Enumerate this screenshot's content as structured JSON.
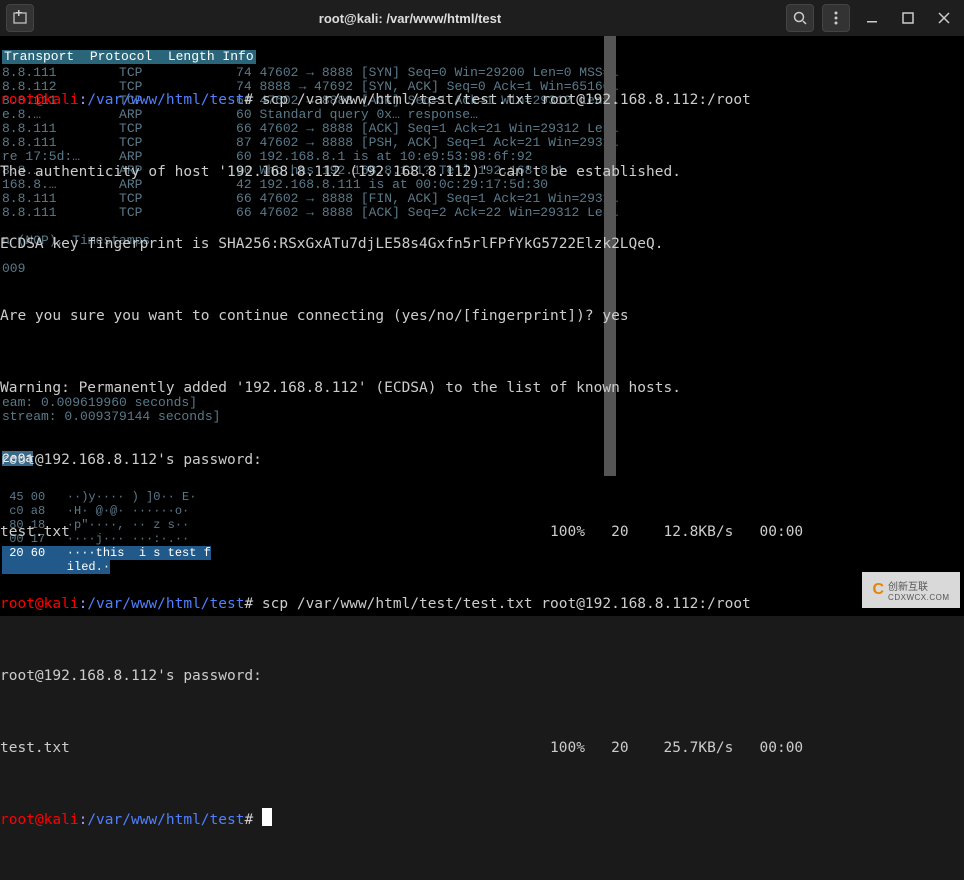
{
  "titlebar": {
    "title": "root@kali: /var/www/html/test"
  },
  "prompt": {
    "userhost": "root@kali",
    "colon": ":",
    "path": "/var/www/html/test",
    "pound": "# "
  },
  "cmd1": "scp /var/www/html/test/test.txt root@192.168.8.112:/root",
  "out": {
    "auth1": "The authenticity of host '192.168.8.112 (192.168.8.112)' can't be established.",
    "auth2": "ECDSA key fingerprint is SHA256:RSxGxATu7djLE58s4Gxfn5rlFPfYkG5722Elzk2LQeQ.",
    "auth3_pre": "Are you sure you want to continue connecting (yes/no/[fingerprint])? ",
    "auth3_ans": "yes",
    "warn": "Warning: Permanently added '192.168.8.112' (ECDSA) to the list of known hosts.",
    "pw1": "root@192.168.8.112's password:",
    "file1": "test.txt",
    "stat1": "100%   20    12.8KB/s   00:00",
    "pw2": "root@192.168.8.112's password:",
    "file2": "test.txt",
    "stat2": "100%   20    25.7KB/s   00:00"
  },
  "cmd2": "scp /var/www/html/test/test.txt root@192.168.8.112:/root",
  "bg": {
    "hdr": "Transport  Protocol  Length Info",
    "rows": [
      "8.8.111        TCP            74 47602 → 8888 [SYN] Seq=0 Win=29200 Len=0 MSS=…",
      "8.8.112        TCP            74 8888 → 47692 [SYN, ACK] Seq=0 Ack=1 Win=65160…",
      "8.8.111        TCP            66 47602 → 8888 [ACK] Seq=1 Ack=1 Win=29312 Len=…",
      "e.8.…          ARP            60 Standard query 0x… response…",
      "8.8.111        TCP            66 47602 → 8888 [ACK] Seq=1 Ack=21 Win=29312 Len…",
      "8.8.111        TCP            87 47602 → 8888 [PSH, ACK] Seq=1 Ack=21 Win=2931…",
      "re 17:5d:…     ARP            60 192.168.8.1 is at 10:e9:53:98:6f:92",
      "8.8.…          ARP            60 Who has 192.168.8.111? Tell 192.168.8.1",
      "168.8.…        ARP            42 192.168.8.111 is at 00:0c:29:17:5d:30",
      "8.8.111        TCP            66 47602 → 8888 [FIN, ACK] Seq=1 Ack=21 Win=2931…",
      "8.8.111        TCP            66 47602 → 8888 [ACK] Seq=2 Ack=22 Win=29312 Len…"
    ],
    "nop": "n (NOP), Timestamps",
    "num": "009",
    "stream1": "eam: 0.009619960 seconds]",
    "stream2": "stream: 0.009379144 seconds]",
    "hexid": "2e0a",
    "hex": [
      " 45 00   ··)y···· ) ]0·· E·",
      " c0 a8   ·H· @·@· ······o·",
      " 80 18   ·p\"····, ·· z s··",
      " 00 17   ····j··· ···:·.·· ",
      " 20 60   ····this  i s test f",
      "         iled.·"
    ]
  },
  "watermark": {
    "brand": "创新互联",
    "sub": "CDXWCX.COM"
  }
}
